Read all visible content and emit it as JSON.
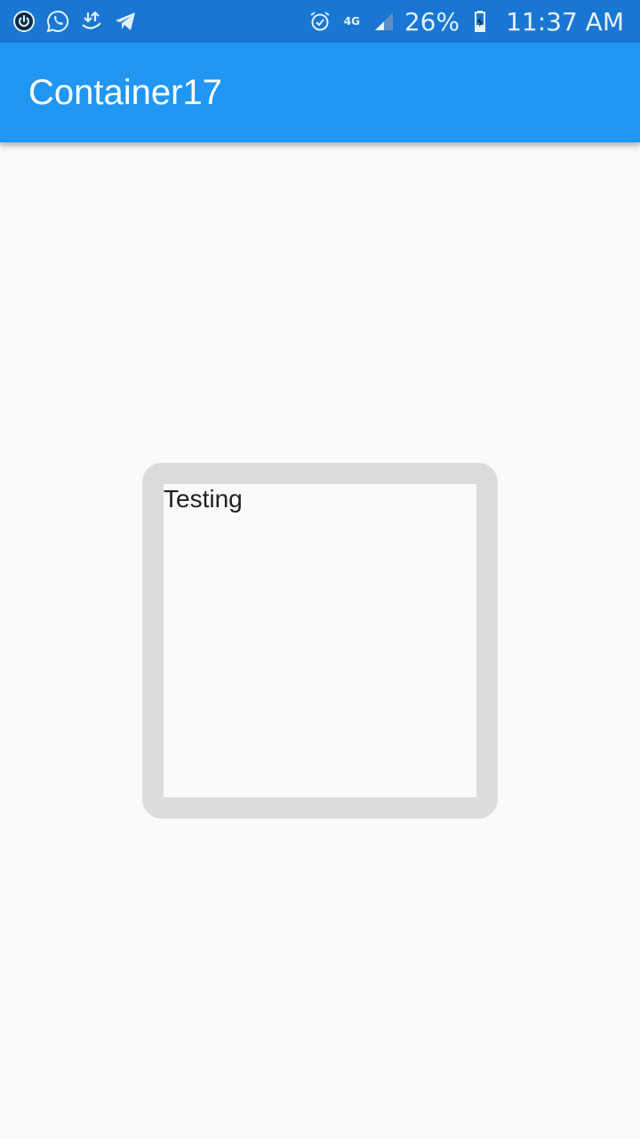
{
  "status_bar": {
    "left_icons": [
      "power-icon",
      "whatsapp-icon",
      "download-upload-icon",
      "telegram-icon"
    ],
    "right_icons": [
      "alarm-icon",
      "network-4g-icon",
      "signal-icon",
      "battery-icon"
    ],
    "network_label": "4G",
    "battery_percent": "26%",
    "time": "11:37 AM"
  },
  "app_bar": {
    "title": "Container17"
  },
  "content": {
    "box_text": "Testing"
  },
  "colors": {
    "status_bar": "#1976d2",
    "app_bar": "#2196f3",
    "background": "#fafafa",
    "box_border": "#dcdcdc",
    "text": "#212121"
  }
}
